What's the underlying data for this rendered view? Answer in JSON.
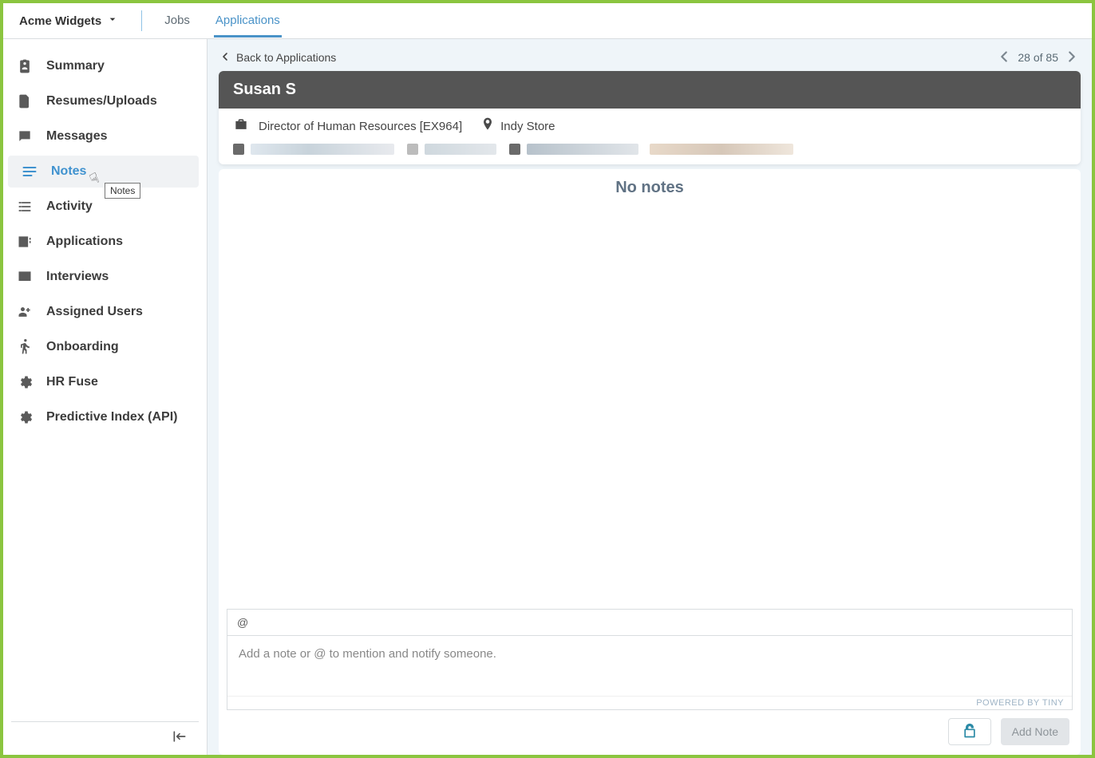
{
  "header": {
    "org": "Acme Widgets",
    "tabs": {
      "jobs": "Jobs",
      "applications": "Applications"
    },
    "active_tab": "applications"
  },
  "sidebar": {
    "items": [
      {
        "label": "Summary",
        "icon": "clipboard-user-icon"
      },
      {
        "label": "Resumes/Uploads",
        "icon": "file-icon"
      },
      {
        "label": "Messages",
        "icon": "message-icon"
      },
      {
        "label": "Notes",
        "icon": "notes-icon"
      },
      {
        "label": "Activity",
        "icon": "list-icon"
      },
      {
        "label": "Applications",
        "icon": "contact-list-icon"
      },
      {
        "label": "Interviews",
        "icon": "people-pane-icon"
      },
      {
        "label": "Assigned Users",
        "icon": "assign-user-icon"
      },
      {
        "label": "Onboarding",
        "icon": "walk-icon"
      },
      {
        "label": "HR Fuse",
        "icon": "gear-icon"
      },
      {
        "label": "Predictive Index (API)",
        "icon": "gear-icon"
      }
    ],
    "selected_index": 3,
    "tooltip_text": "Notes"
  },
  "applicant": {
    "back_label": "Back to Applications",
    "pager_text": "28 of 85",
    "name": "Susan S",
    "job_title": "Director of Human Resources [EX964]",
    "location": "Indy Store"
  },
  "notes": {
    "empty_message": "No notes",
    "toolbar_mention": "@",
    "placeholder": "Add a note or @ to mention and notify someone.",
    "powered_by": "POWERED BY TINY",
    "add_button": "Add Note"
  },
  "colors": {
    "accent_blue": "#4a93c8",
    "dark_bar": "#555555",
    "green_border": "#8bc53f"
  }
}
